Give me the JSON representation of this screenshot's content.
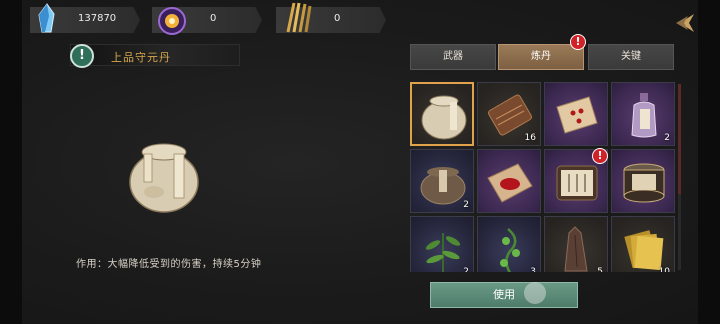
{
  "resources": [
    {
      "icon": "crystal-icon",
      "value": "137870"
    },
    {
      "icon": "glowing-orb-icon",
      "value": "0"
    },
    {
      "icon": "arrows-bundle-icon",
      "value": "0"
    }
  ],
  "settings_icon": "settings-arrow-icon",
  "selected_item": {
    "name": "上品守元丹",
    "description": "作用：大幅降低受到的伤害，持续5分钟"
  },
  "tabs": [
    {
      "label": "武器",
      "active": false,
      "badge": ""
    },
    {
      "label": "炼丹",
      "active": true,
      "badge": "!"
    },
    {
      "label": "关键",
      "active": false,
      "badge": ""
    }
  ],
  "inventory": [
    {
      "item": "ceramic-jar",
      "rarity": "dark",
      "count": "",
      "selected": true,
      "badge": ""
    },
    {
      "item": "bamboo-scroll",
      "rarity": "dark",
      "count": "16",
      "selected": false,
      "badge": ""
    },
    {
      "item": "red-seal-paper",
      "rarity": "purple",
      "count": "",
      "selected": false,
      "badge": ""
    },
    {
      "item": "purple-bottle",
      "rarity": "purple",
      "count": "2",
      "selected": false,
      "badge": ""
    },
    {
      "item": "clay-pot",
      "rarity": "blue",
      "count": "2",
      "selected": false,
      "badge": ""
    },
    {
      "item": "blood-paper",
      "rarity": "purple",
      "count": "",
      "selected": false,
      "badge": ""
    },
    {
      "item": "talisman-roll",
      "rarity": "purple",
      "count": "",
      "selected": false,
      "badge": "!"
    },
    {
      "item": "ornate-box",
      "rarity": "purple",
      "count": "",
      "selected": false,
      "badge": ""
    },
    {
      "item": "herb-plant",
      "rarity": "blue",
      "count": "2",
      "selected": false,
      "badge": ""
    },
    {
      "item": "vine-herb",
      "rarity": "blue",
      "count": "3",
      "selected": false,
      "badge": ""
    },
    {
      "item": "tree-stump",
      "rarity": "dark",
      "count": "5",
      "selected": false,
      "badge": ""
    },
    {
      "item": "gold-papers",
      "rarity": "dark",
      "count": "10",
      "selected": false,
      "badge": ""
    }
  ],
  "use_button": "使用",
  "alert_glyph": "!"
}
